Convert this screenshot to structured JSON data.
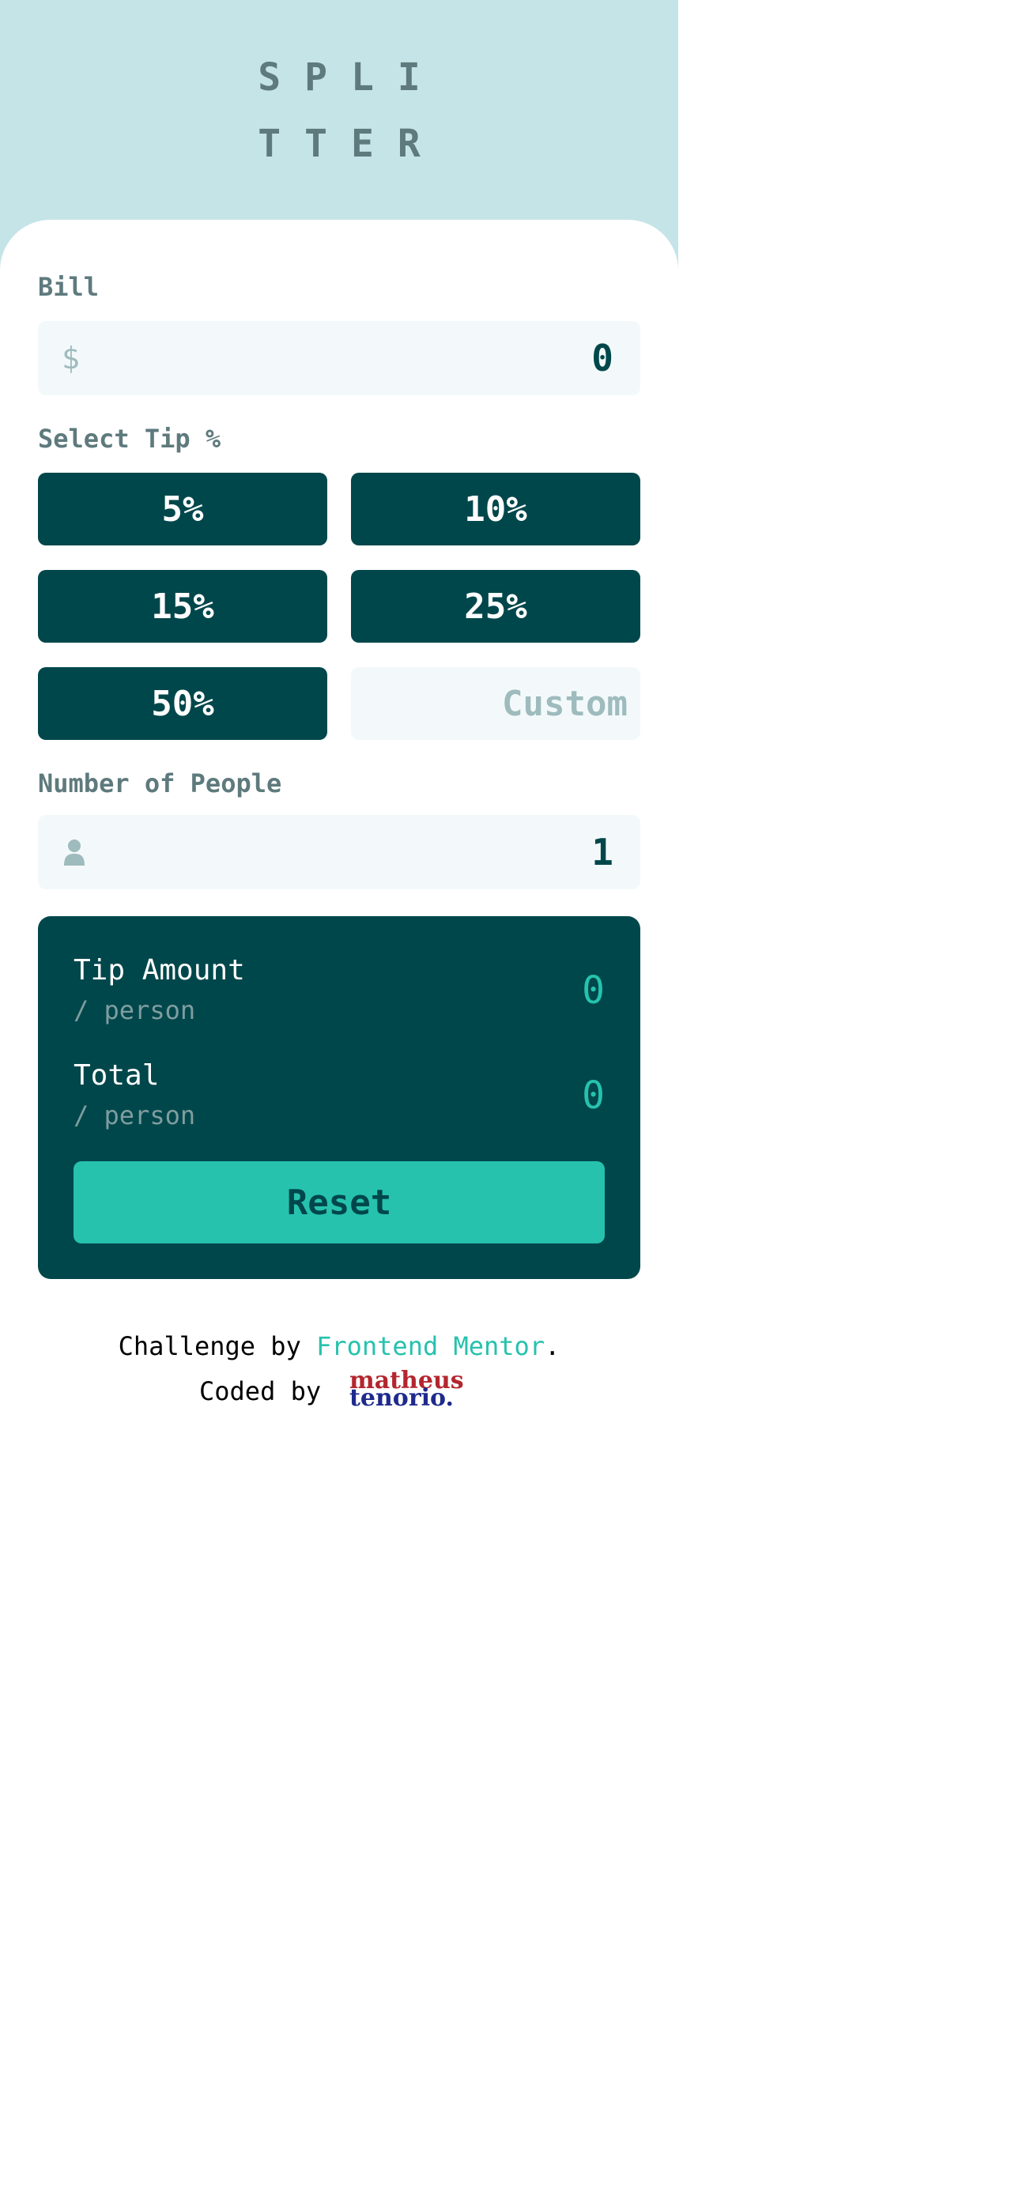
{
  "app": {
    "logo_line1": "SPLI",
    "logo_line2": "TTER"
  },
  "bill": {
    "label": "Bill",
    "currency_symbol": "$",
    "value": "0"
  },
  "tip": {
    "label": "Select Tip %",
    "options": [
      "5%",
      "10%",
      "15%",
      "25%",
      "50%"
    ],
    "custom_placeholder": "Custom"
  },
  "people": {
    "label": "Number of People",
    "icon": "person-icon",
    "value": "1"
  },
  "results": {
    "tip_amount_label": "Tip Amount",
    "tip_amount_sub": "/ person",
    "tip_amount_value": "0",
    "total_label": "Total",
    "total_sub": "/ person",
    "total_value": "0",
    "reset_label": "Reset"
  },
  "footer": {
    "challenge_prefix": "Challenge by",
    "challenge_link": "Frontend Mentor",
    "challenge_suffix": ".",
    "coded_by": "Coded by",
    "author_line1": "matheus",
    "author_line2": "tenorio."
  },
  "colors": {
    "hero_bg": "#c5e4e7",
    "dark_cyan": "#00474b",
    "strong_cyan": "#26c2ae",
    "grayish_cyan": "#5e7a7d",
    "input_bg": "#f3f9fa"
  }
}
